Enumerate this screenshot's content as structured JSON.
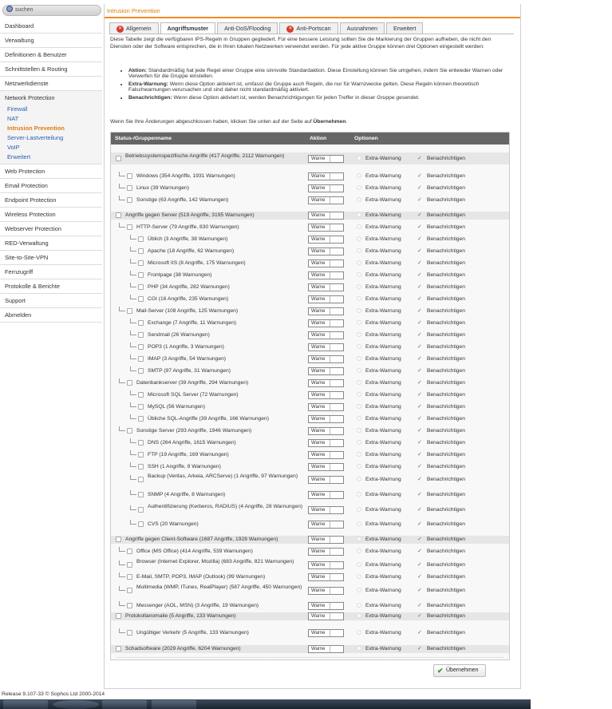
{
  "search": {
    "placeholder": "suchen"
  },
  "nav": [
    {
      "label": "Dashboard"
    },
    {
      "label": "Verwaltung"
    },
    {
      "label": "Definitionen & Benutzer"
    },
    {
      "label": "Schnittstellen & Routing"
    },
    {
      "label": "Netzwerkdienste"
    },
    {
      "label": "Network Protection",
      "sub": [
        "Firewall",
        "NAT",
        "Intrusion Prevention",
        "Server-Lastverteilung",
        "VoIP",
        "Erweitert"
      ],
      "active": "Intrusion Prevention"
    },
    {
      "label": "Web Protection"
    },
    {
      "label": "Email Protection"
    },
    {
      "label": "Endpoint Protection"
    },
    {
      "label": "Wireless Protection"
    },
    {
      "label": "Webserver Protection"
    },
    {
      "label": "RED-Verwaltung"
    },
    {
      "label": "Site-to-Site-VPN"
    },
    {
      "label": "Fernzugriff"
    },
    {
      "label": "Protokolle & Berichte"
    },
    {
      "label": "Support"
    },
    {
      "label": "Abmelden"
    }
  ],
  "title": "Intrusion Prevention",
  "tabs": [
    {
      "label": "Allgemein",
      "status": "off"
    },
    {
      "label": "Angriffsmuster",
      "active": true
    },
    {
      "label": "Anti-DoS/Flooding"
    },
    {
      "label": "Anti-Portscan",
      "status": "off"
    },
    {
      "label": "Ausnahmen"
    },
    {
      "label": "Erweitert"
    }
  ],
  "description": "Diese Tabelle zeigt die verfügbaren IPS-Regeln in Gruppen gegliedert. Für eine bessere Leistung sollten Sie die Markierung der Gruppen aufheben, die nicht den Diensten oder der Software entsprechen, die in Ihren lokalen Netzwerken verwendet werden. Für jede aktive Gruppe können drei Optionen eingestellt werden:",
  "bullets": [
    {
      "bold": "Aktion:",
      "text": " Standardmäßig hat jede Regel einer Gruppe eine sinnvolle Standardaktion. Diese Einstellung können Sie umgehen, indem Sie entweder Warnen oder Verwerfen für die Gruppe einstellen."
    },
    {
      "bold": "Extra-Warnung:",
      "text": " Wenn diese Option aktiviert ist, umfasst die Gruppe auch Regeln, die nur für Warnzwecke gelten. Diese Regeln können theoretisch Falschwarnungen verursachen und sind daher nicht standardmäßig aktiviert."
    },
    {
      "bold": "Benachrichtigen:",
      "text": " Wenn diese Option aktiviert ist, werden Benachrichtigungen für jeden Treffer in dieser Gruppe gesendet."
    }
  ],
  "hint_pre": "Wenn Sie Ihre Änderungen abgeschlossen haben, klicken Sie unten auf der Seite auf ",
  "hint_bold": "Übernehmen",
  "hint_post": ".",
  "table": {
    "headers": {
      "name": "Status-/Gruppenname",
      "action": "Aktion",
      "options": "Optionen"
    },
    "action_value": "Warne",
    "extra_label": "Extra-Warnung",
    "notify_label": "Benachrichtigen",
    "rows": [
      {
        "level": 0,
        "name": "Betriebssystemspezifische Angriffe (417 Angriffe, 2112 Warnungen)"
      },
      {
        "level": 1,
        "name": "Windows (354 Angriffe, 1931 Warnungen)"
      },
      {
        "level": 1,
        "name": "Linux (39 Warnungen)"
      },
      {
        "level": 1,
        "name": "Sonstige (63 Angriffe, 142 Warnungen)"
      },
      {
        "level": 0,
        "name": "Angriffe gegen Server (519 Angriffe, 3195 Warnungen)"
      },
      {
        "level": 1,
        "name": "HTTP-Server (79 Angriffe, 830 Warnungen)"
      },
      {
        "level": 2,
        "name": "Üblich (3 Angriffe, 38 Warnungen)"
      },
      {
        "level": 2,
        "name": "Apache (18 Angriffe, 62 Warnungen)"
      },
      {
        "level": 2,
        "name": "Microsoft IIS (8 Angriffe, 175 Warnungen)"
      },
      {
        "level": 2,
        "name": "Frontpage (38 Warnungen)"
      },
      {
        "level": 2,
        "name": "PHP (34 Angriffe, 282 Warnungen)"
      },
      {
        "level": 2,
        "name": "CGI (16 Angriffe, 235 Warnungen)"
      },
      {
        "level": 1,
        "name": "Mail-Server (108 Angriffe, 125 Warnungen)"
      },
      {
        "level": 2,
        "name": "Exchange (7 Angriffe, 11 Warnungen)"
      },
      {
        "level": 2,
        "name": "Sendmail (26 Warnungen)"
      },
      {
        "level": 2,
        "name": "POP3 (1 Angriffe, 3 Warnungen)"
      },
      {
        "level": 2,
        "name": "IMAP (3 Angriffe, 54 Warnungen)"
      },
      {
        "level": 2,
        "name": "SMTP (97 Angriffe, 31 Warnungen)"
      },
      {
        "level": 1,
        "name": "Datenbankserver (39 Angriffe, 294 Warnungen)"
      },
      {
        "level": 2,
        "name": "Microsoft SQL Server (72 Warnungen)"
      },
      {
        "level": 2,
        "name": "MySQL (56 Warnungen)"
      },
      {
        "level": 2,
        "name": "Übliche SQL-Angriffe (39 Angriffe, 166 Warnungen)"
      },
      {
        "level": 1,
        "name": "Sonstige Server (293 Angriffe, 1946 Warnungen)"
      },
      {
        "level": 2,
        "name": "DNS (264 Angriffe, 1615 Warnungen)"
      },
      {
        "level": 2,
        "name": "FTP (19 Angriffe, 169 Warnungen)"
      },
      {
        "level": 2,
        "name": "SSH (1 Angriffe, 9 Warnungen)"
      },
      {
        "level": 2,
        "name": "Backup (Veritas, Arkeia, ARCServe) (1 Angriffe, 97 Warnungen)"
      },
      {
        "level": 2,
        "name": "SNMP (4 Angriffe, 8 Warnungen)"
      },
      {
        "level": 2,
        "name": "Authentifizierung (Kerberos, RADIUS) (4 Angriffe, 28 Warnungen)"
      },
      {
        "level": 2,
        "name": "CVS (20 Warnungen)"
      },
      {
        "level": 0,
        "name": "Angriffe gegen Client-Software (1687 Angriffe, 1928 Warnungen)"
      },
      {
        "level": 1,
        "name": "Office (MS Office) (414 Angriffe, 539 Warnungen)"
      },
      {
        "level": 1,
        "name": "Browser (Internet Explorer, Mozilla) (683 Angriffe, 821 Warnungen)"
      },
      {
        "level": 1,
        "name": "E-Mail, SMTP, POP3, IMAP (Outlook) (99 Warnungen)"
      },
      {
        "level": 1,
        "name": "Multimedia (WMP, ITunes, RealPlayer) (587 Angriffe, 450 Warnungen)"
      },
      {
        "level": 1,
        "name": "Messenger (AOL, MSN) (3 Angriffe, 19 Warnungen)"
      },
      {
        "level": 0,
        "name": "Protokollanomalie (5 Angriffe, 133 Warnungen)"
      },
      {
        "level": 1,
        "name": "Ungültiger Verkehr (5 Angriffe, 133 Warnungen)"
      },
      {
        "level": 0,
        "name": "Schadsoftware (2029 Angriffe, 6204 Warnungen)"
      }
    ]
  },
  "apply_label": "Übernehmen",
  "footer": "Release 9.107-33 © Sophos Ltd 2000-2014"
}
